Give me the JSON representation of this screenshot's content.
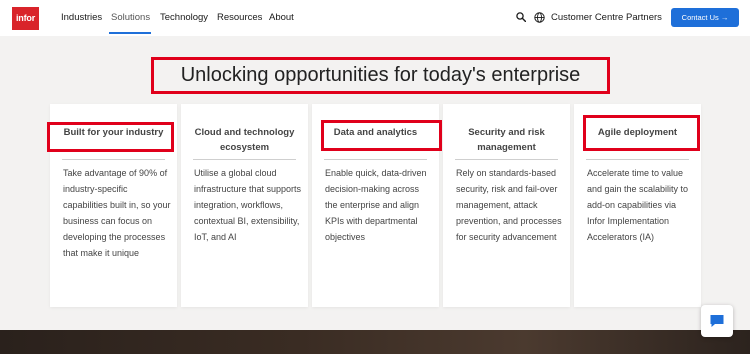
{
  "header": {
    "logo_text": "infor",
    "nav": [
      {
        "label": "Industries"
      },
      {
        "label": "Solutions"
      },
      {
        "label": "Technology"
      },
      {
        "label": "Resources"
      },
      {
        "label": "About"
      }
    ],
    "icons": {
      "search": "search-icon",
      "globe": "globe-icon"
    },
    "customer_centre": "Customer Centre",
    "partners": "Partners",
    "contact_button": "Contact Us →"
  },
  "main": {
    "title": "Unlocking opportunities for today's enterprise",
    "cards": [
      {
        "title": "Built for your industry",
        "description": "Take advantage of 90% of industry-specific capabilities built in, so your business can focus on developing the processes that make it unique"
      },
      {
        "title": "Cloud and technology ecosystem",
        "description": "Utilise a global cloud infrastructure that supports integration, workflows, contextual BI, extensibility, IoT, and AI"
      },
      {
        "title": "Data and analytics",
        "description": "Enable quick, data-driven decision-making across the enterprise and align KPIs with departmental objectives"
      },
      {
        "title": "Security and risk management",
        "description": "Rely on standards-based security, risk and fail-over management, attack prevention, and processes for security advancement"
      },
      {
        "title": "Agile deployment",
        "description": "Accelerate time to value and gain the scalability to add-on capabilities via Infor Implementation Accelerators (IA)"
      }
    ]
  },
  "colors": {
    "brand_red": "#d9242a",
    "accent_blue": "#1e6fd9",
    "highlight_red": "#e0001b",
    "page_background": "#f3f2f1"
  },
  "chat": {
    "icon": "chat-icon"
  }
}
